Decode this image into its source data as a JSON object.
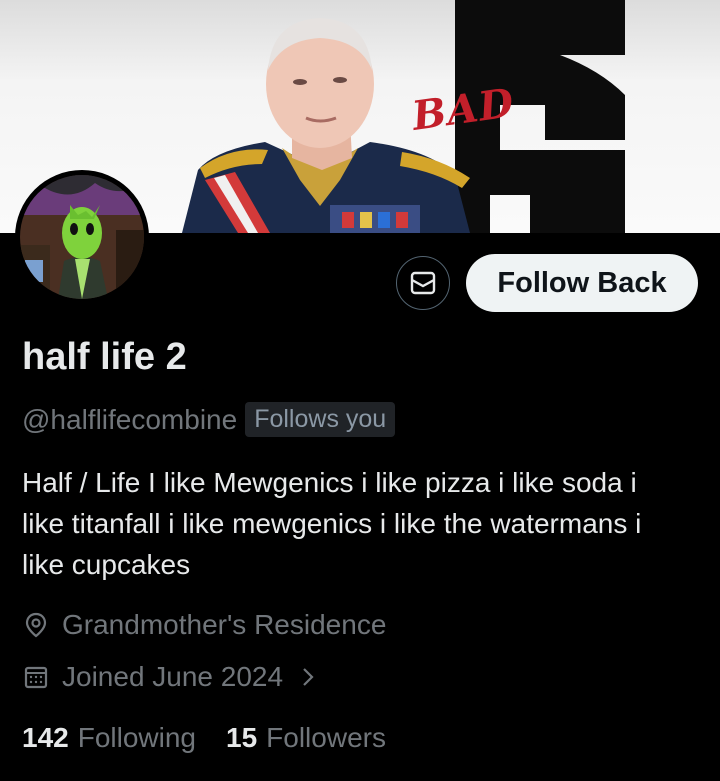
{
  "header": {
    "banner_text": "BAD",
    "dm_icon": "envelope-icon",
    "follow_label": "Follow Back"
  },
  "profile": {
    "display_name": "half life 2",
    "handle": "@halflifecombine",
    "follows_you": "Follows you",
    "bio": "Half / Life I like Mewgenics i like pizza i like soda i like titanfall i like mewgenics i like the watermans i like cupcakes",
    "location": "Grandmother's Residence",
    "location_icon": "location-pin-icon",
    "joined": "Joined June 2024",
    "joined_icon": "calendar-icon"
  },
  "stats": {
    "following_count": "142",
    "following_label": "Following",
    "followers_count": "15",
    "followers_label": "Followers"
  },
  "colors": {
    "background": "#000000",
    "text": "#e7e9ea",
    "muted": "#71767b",
    "button_bg": "#eff3f4"
  }
}
